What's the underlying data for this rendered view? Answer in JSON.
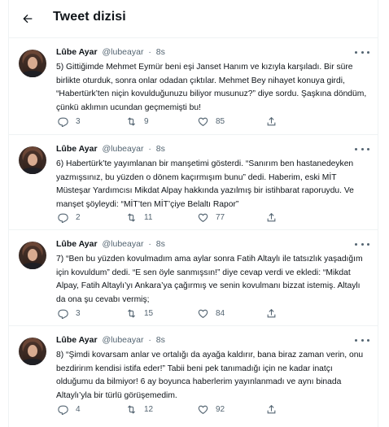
{
  "header": {
    "title": "Tweet dizisi",
    "back_icon": "arrow-left-icon"
  },
  "tweets": [
    {
      "name": "Lûbe Ayar",
      "handle": "@lubeayar",
      "dot": "·",
      "time": "8s",
      "text": "5) Gittiğimde Mehmet Eymür beni eşi Janset Hanım ve kızıyla karşıladı. Bir süre birlikte oturduk, sonra onlar odadan çıktılar. Mehmet Bey nihayet konuya girdi, “Habertürk’ten niçin kovulduğunuzu biliyor musunuz?” diye sordu. Şaşkına döndüm, çünkü aklımın ucundan geçmemişti bu!",
      "replies": "3",
      "retweets": "9",
      "likes": "85"
    },
    {
      "name": "Lûbe Ayar",
      "handle": "@lubeayar",
      "dot": "·",
      "time": "8s",
      "text": "6) Habertürk’te yayımlanan bir manşetimi gösterdi. “Sanırım ben hastanedeyken yazmışsınız, bu yüzden o dönem kaçırmışım bunu” dedi. Haberim, eski MİT Müsteşar Yardımcısı Mikdat Alpay hakkında yazılmış bir istihbarat raporuydu. Ve manşet şöyleydi: “MİT’ten MİT’çiye Belaltı Rapor”",
      "replies": "2",
      "retweets": "11",
      "likes": "77"
    },
    {
      "name": "Lûbe Ayar",
      "handle": "@lubeayar",
      "dot": "·",
      "time": "8s",
      "text": "7) “Ben bu yüzden kovulmadım ama aylar sonra Fatih Altaylı ile tatsızlık yaşadığım için kovuldum” dedi. “E sen öyle sanmışsın!” diye cevap verdi ve ekledi: “Mikdat Alpay, Fatih Altaylı’yı Ankara’ya çağırmış ve senin kovulmanı bizzat istemiş. Altaylı da ona şu cevabı vermiş;",
      "replies": "3",
      "retweets": "15",
      "likes": "84"
    },
    {
      "name": "Lûbe Ayar",
      "handle": "@lubeayar",
      "dot": "·",
      "time": "8s",
      "text": "8) “Şimdi kovarsam anlar ve ortalığı da ayağa kaldırır, bana biraz zaman verin, onu bezdirirım kendisi istifa eder!” Tabii beni pek tanımadığı için ne kadar inatçı olduğumu da bilmiyor! 6 ay boyunca haberlerim yayınlanmadı ve aynı binada Altaylı’yla bir türlü görüşemedim.",
      "replies": "4",
      "retweets": "12",
      "likes": "92"
    }
  ],
  "icons": {
    "reply": "reply-icon",
    "retweet": "retweet-icon",
    "like": "heart-icon",
    "share": "share-icon",
    "more": "more-icon"
  },
  "colors": {
    "text": "#0f1419",
    "secondary": "#536471",
    "border": "#eff3f4"
  }
}
